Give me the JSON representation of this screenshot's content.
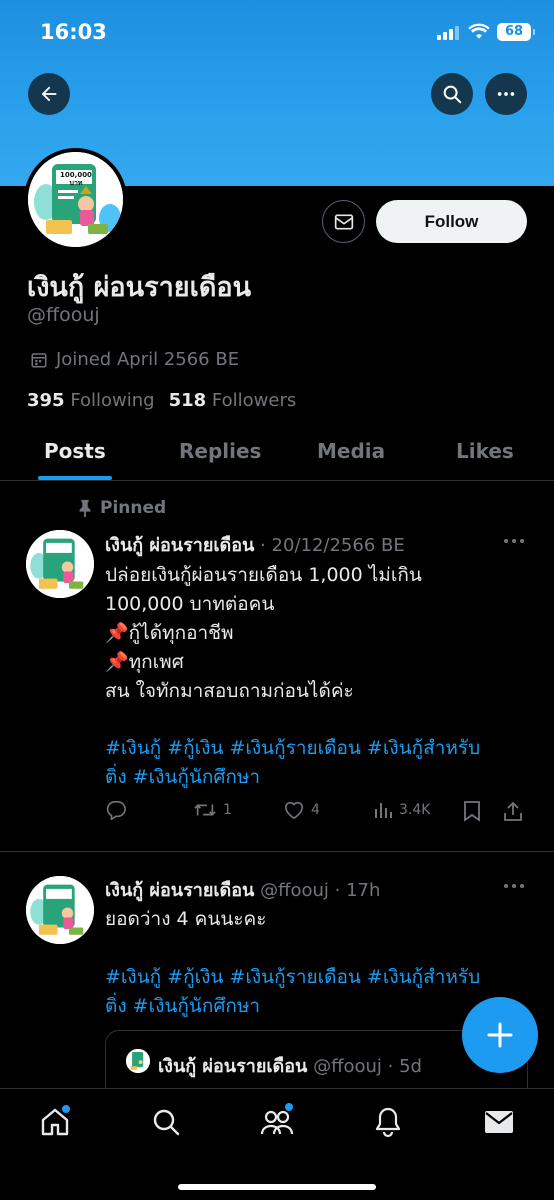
{
  "status_bar": {
    "time": "16:03",
    "battery": "68"
  },
  "profile": {
    "display_name": "เงินกู้ ผ่อนรายเดือน",
    "handle": "@ffoouj",
    "joined": "Joined April 2566 BE",
    "following_count": "395",
    "following_label": "Following",
    "followers_count": "518",
    "followers_label": "Followers",
    "follow_button": "Follow",
    "avatar_text": "100,000 บาท"
  },
  "tabs": [
    {
      "label": "Posts",
      "active": true
    },
    {
      "label": "Replies",
      "active": false
    },
    {
      "label": "Media",
      "active": false
    },
    {
      "label": "Likes",
      "active": false
    }
  ],
  "posts": [
    {
      "pinned_label": "Pinned",
      "name": "เงินกู้ ผ่อนรายเดือน",
      "meta": "· 20/12/2566 BE",
      "text_lines": [
        "ปล่อยเงินกู้ผ่อนรายเดือน 1,000 ไม่เกิน",
        "100,000 บาทต่อคน",
        "📌กู้ได้ทุกอาชีพ",
        "📌ทุกเพศ",
        "สน ใจทักมาสอบถามก่อนได้ค่ะ"
      ],
      "hashtags_line1": "#เงินกู้ #กู้เงิน #เงินกู้รายเดือน #เงินกู้สำหรับ",
      "hashtags_line2": "ติ่ง #เงินกู้นักศึกษา",
      "retweets": "1",
      "likes": "4",
      "views": "3.4K"
    },
    {
      "name": "เงินกู้ ผ่อนรายเดือน",
      "meta": "@ffoouj · 17h",
      "text_lines": [
        "ยอดว่าง 4 คนนะคะ"
      ],
      "hashtags_line1": "#เงินกู้ #กู้เงิน #เงินกู้รายเดือน #เงินกู้สำหรับ",
      "hashtags_line2": "ติ่ง #เงินกู้นักศึกษา",
      "quote": {
        "name": "เงินกู้ ผ่อนรายเดือน",
        "meta": "@ffoouj · 5d"
      }
    }
  ],
  "colors": {
    "accent": "#1d9bf0",
    "banner": "#2aa1ec",
    "muted": "#71767b"
  },
  "icons": {
    "back": "arrow-left-icon",
    "search": "search-icon",
    "more": "more-icon",
    "message": "envelope-icon",
    "calendar": "calendar-icon",
    "pin": "pin-icon",
    "reply": "reply-icon",
    "retweet": "retweet-icon",
    "like": "heart-icon",
    "views": "views-icon",
    "bookmark": "bookmark-icon",
    "share": "share-icon",
    "compose": "plus-icon",
    "home": "home-icon",
    "explore": "search-icon",
    "communities": "people-icon",
    "notifications": "bell-icon",
    "messages": "envelope-icon"
  }
}
